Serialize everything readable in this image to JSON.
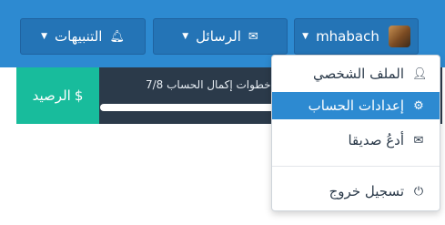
{
  "nav": {
    "alerts_label": "التنبيهات",
    "alerts_icon": "bell-icon",
    "messages_label": "الرسائل",
    "messages_icon": "envelope-icon",
    "username": "mhabach",
    "caret_icon": "caret-down-icon"
  },
  "status": {
    "balance_label": "الرصيد",
    "balance_icon": "dollar-icon",
    "progress_text": "خطوات إكمال الحساب 7/8",
    "progress_steps_done": 7,
    "progress_steps_total": 8
  },
  "user_menu": {
    "items": [
      {
        "label": "الملف الشخصي",
        "icon": "user-icon"
      },
      {
        "label": "إعدادات الحساب",
        "icon": "gear-icon",
        "active": true
      },
      {
        "label": "أدعُ صديقا",
        "icon": "envelope-icon"
      },
      {
        "label": "تسجيل خروج",
        "icon": "power-icon"
      }
    ]
  },
  "colors": {
    "topbar": "#2d8ad1",
    "nav_button": "#2474b6",
    "statusbar": "#2b3a4a",
    "balance": "#18bc9c",
    "menu_active": "#2d8ad1"
  }
}
